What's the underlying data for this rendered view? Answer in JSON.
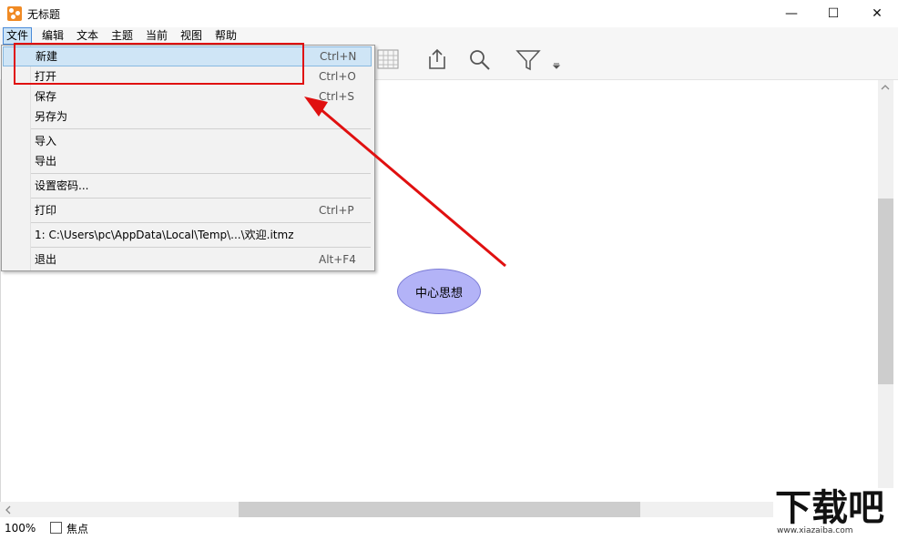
{
  "window": {
    "title": "无标题",
    "minimize": "—",
    "maximize": "☐",
    "close": "✕"
  },
  "menubar": [
    "文件",
    "编辑",
    "文本",
    "主题",
    "当前",
    "视图",
    "帮助"
  ],
  "file_menu": {
    "items": [
      {
        "label": "新建",
        "shortcut": "Ctrl+N"
      },
      {
        "label": "打开",
        "shortcut": "Ctrl+O"
      },
      {
        "label": "保存",
        "shortcut": "Ctrl+S"
      },
      {
        "label": "另存为",
        "shortcut": ""
      },
      {
        "label": "导入",
        "shortcut": ""
      },
      {
        "label": "导出",
        "shortcut": ""
      },
      {
        "label": "设置密码...",
        "shortcut": ""
      },
      {
        "label": "打印",
        "shortcut": "Ctrl+P"
      },
      {
        "label": "1:  C:\\Users\\pc\\AppData\\Local\\Temp\\...\\欢迎.itmz",
        "shortcut": ""
      },
      {
        "label": "退出",
        "shortcut": "Alt+F4"
      }
    ]
  },
  "toolbar_icons": [
    "grid-icon",
    "share-icon",
    "search-icon",
    "filter-icon"
  ],
  "canvas": {
    "central_node": "中心思想"
  },
  "status": {
    "zoom": "100%",
    "focus_label": "焦点"
  },
  "watermark": {
    "text": "下载吧",
    "url": "www.xiazaiba.com"
  },
  "colors": {
    "node_fill": "#b3b3f7",
    "annotation_red": "#e01010",
    "highlight_blue": "#cfe5f6"
  }
}
